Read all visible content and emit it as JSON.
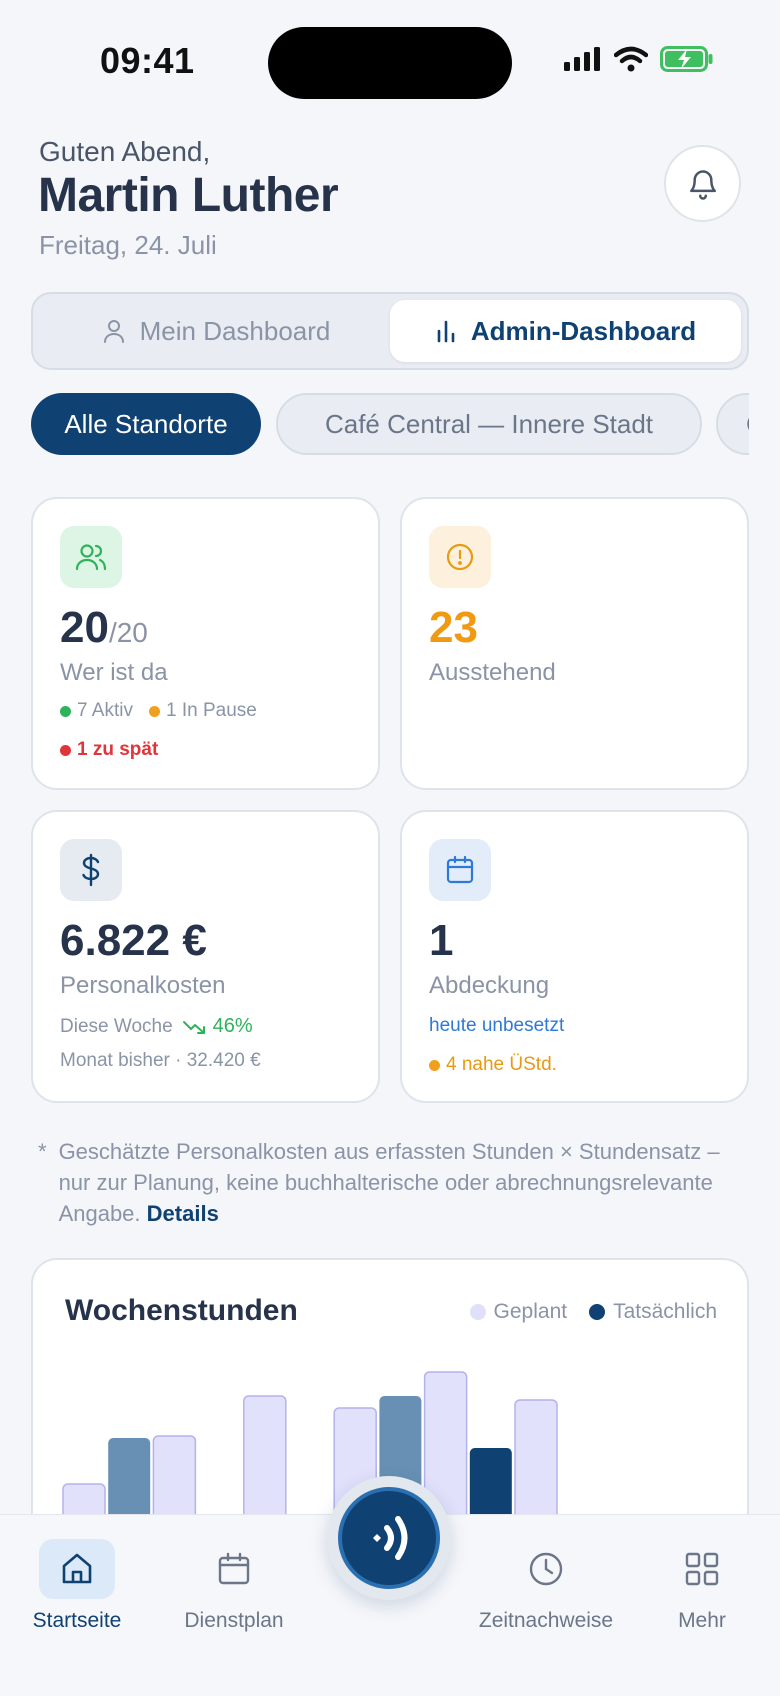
{
  "status_bar": {
    "time": "09:41"
  },
  "header": {
    "greeting": "Guten Abend,",
    "name": "Martin Luther",
    "date": "Freitag, 24. Juli"
  },
  "segment": {
    "tabs": [
      {
        "label": "Mein Dashboard",
        "active": false,
        "icon": "user-icon"
      },
      {
        "label": "Admin-Dashboard",
        "active": true,
        "icon": "bar-chart-icon"
      }
    ]
  },
  "locations": {
    "chips": [
      "Alle Standorte",
      "Café Central — Innere Stadt",
      "Ca"
    ],
    "selected": "Alle Standorte"
  },
  "cards": {
    "attendance": {
      "value": "20",
      "total": "/20",
      "label": "Wer ist da",
      "active": "7 Aktiv",
      "pause": "1 In Pause",
      "late": "1 zu spät",
      "icon": "users-icon"
    },
    "pending": {
      "value": "23",
      "label": "Ausstehend",
      "icon": "alert-circle-icon"
    },
    "costs": {
      "value": "6.822 €",
      "label": "Personalkosten",
      "week_label": "Diese Woche",
      "week_trend": "46%",
      "month": "Monat bisher · 32.420 €",
      "icon": "dollar-icon"
    },
    "coverage": {
      "value": "1",
      "label": "Abdeckung",
      "unfilled": "heute unbesetzt",
      "overtime": "4 nahe ÜStd.",
      "icon": "calendar-icon"
    }
  },
  "note": {
    "star": "*",
    "text": "Geschätzte Personalkosten aus erfassten Stunden × Stundensatz – nur zur Planung, keine buchhalterische oder abrechnungsrelevante Angabe.",
    "link": "Details"
  },
  "chart_data": {
    "type": "bar",
    "title": "Wochenstunden",
    "series": [
      {
        "name": "Geplant",
        "color": "#e0e0fa"
      },
      {
        "name": "Tatsächlich",
        "color": "#0f4272"
      }
    ],
    "bars": [
      {
        "series": "Geplant",
        "value": 98
      },
      {
        "series": "Tatsächlich",
        "value": 121
      },
      {
        "series": "Geplant",
        "value": 122
      },
      {
        "series": "Geplant",
        "value": 142
      },
      {
        "series": "Geplant",
        "value": 136
      },
      {
        "series": "Tatsächlich",
        "value": 142
      },
      {
        "series": "Geplant",
        "value": 154
      },
      {
        "series": "Tatsächlich",
        "value": 116
      },
      {
        "series": "Geplant",
        "value": 140
      }
    ]
  },
  "tabbar": {
    "tabs": [
      {
        "label": "Startseite",
        "icon": "home-icon",
        "active": true
      },
      {
        "label": "Dienstplan",
        "icon": "calendar-icon",
        "active": false
      },
      {
        "label": "Zeitnachweise",
        "icon": "clock-icon",
        "active": false
      },
      {
        "label": "Mehr",
        "icon": "grid-icon",
        "active": false
      }
    ],
    "fab_icon": "nfc-icon"
  }
}
